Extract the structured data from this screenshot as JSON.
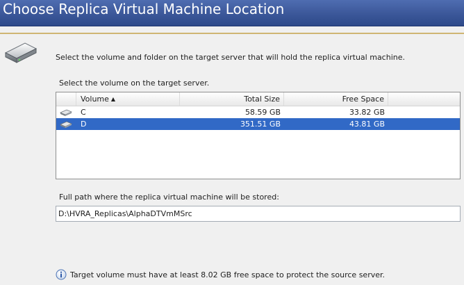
{
  "header": {
    "title": "Choose Replica Virtual Machine Location"
  },
  "intro_text": "Select the volume and folder on the target server that will hold the replica virtual machine.",
  "volume_group": {
    "label": "Select the volume on the target server.",
    "columns": {
      "volume": "Volume",
      "total_size": "Total Size",
      "free_space": "Free Space"
    },
    "rows": [
      {
        "volume": "C",
        "total_size": "58.59 GB",
        "free_space": "33.82 GB",
        "selected": false
      },
      {
        "volume": "D",
        "total_size": "351.51 GB",
        "free_space": "43.81 GB",
        "selected": true
      }
    ],
    "sort_icon": "sort-ascending-icon"
  },
  "path": {
    "label": "Full path where the replica virtual machine will be stored:",
    "value": "D:\\HVRA_Replicas\\AlphaDTVmMSrc"
  },
  "info": {
    "icon": "info-icon",
    "text": "Target volume must have at least 8.02 GB free space to protect the source server."
  },
  "colors": {
    "header_bg": "#3b5799",
    "accent_line": "#cfb573",
    "selection": "#3169c6"
  }
}
